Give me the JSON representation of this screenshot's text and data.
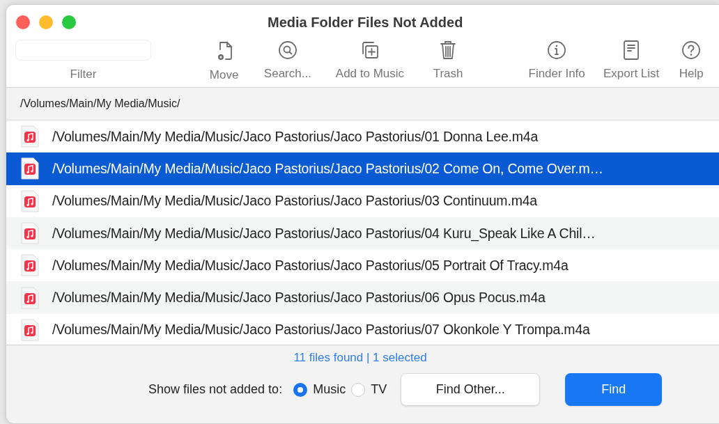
{
  "window": {
    "title": "Media Folder Files Not Added"
  },
  "filter": {
    "label": "Filter"
  },
  "toolbar": [
    {
      "label": "Move"
    },
    {
      "label": "Search..."
    },
    {
      "label": "Add to Music"
    },
    {
      "label": "Trash"
    },
    {
      "label": "Finder Info"
    },
    {
      "label": "Export List"
    },
    {
      "label": "Help"
    }
  ],
  "folder_path": "/Volumes/Main/My Media/Music/",
  "files": [
    {
      "path": "/Volumes/Main/My Media/Music/Jaco Pastorius/Jaco Pastorius/01 Donna Lee.m4a",
      "selected": false
    },
    {
      "path": "/Volumes/Main/My Media/Music/Jaco Pastorius/Jaco Pastorius/02 Come On, Come Over.m…",
      "selected": true
    },
    {
      "path": "/Volumes/Main/My Media/Music/Jaco Pastorius/Jaco Pastorius/03 Continuum.m4a",
      "selected": false
    },
    {
      "path": "/Volumes/Main/My Media/Music/Jaco Pastorius/Jaco Pastorius/04 Kuru_Speak Like A Chil…",
      "selected": false
    },
    {
      "path": "/Volumes/Main/My Media/Music/Jaco Pastorius/Jaco Pastorius/05 Portrait Of Tracy.m4a",
      "selected": false
    },
    {
      "path": "/Volumes/Main/My Media/Music/Jaco Pastorius/Jaco Pastorius/06 Opus Pocus.m4a",
      "selected": false
    },
    {
      "path": "/Volumes/Main/My Media/Music/Jaco Pastorius/Jaco Pastorius/07 Okonkole Y Trompa.m4a",
      "selected": false
    }
  ],
  "status": "11 files found | 1 selected",
  "show_files": {
    "label": "Show files not added to:",
    "options": [
      {
        "label": "Music",
        "selected": true
      },
      {
        "label": "TV",
        "selected": false
      }
    ]
  },
  "buttons": [
    {
      "label": "Find Other...",
      "kind": "secondary"
    },
    {
      "label": "Find",
      "kind": "primary"
    }
  ]
}
